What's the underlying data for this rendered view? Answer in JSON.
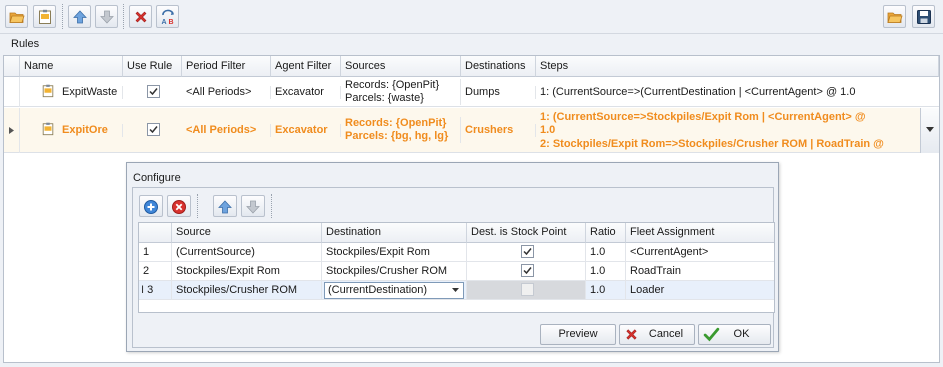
{
  "toolbar": {
    "left_icons": [
      "open-folder-icon",
      "properties-icon",
      "move-up-icon",
      "move-down-icon",
      "delete-icon",
      "rename-icon"
    ],
    "right_icons": [
      "open-folder-icon",
      "save-icon"
    ]
  },
  "rules": {
    "section_label": "Rules",
    "columns": [
      "Name",
      "Use Rule",
      "Period Filter",
      "Agent Filter",
      "Sources",
      "Destinations",
      "Steps"
    ],
    "rows": [
      {
        "name": "ExpitWaste",
        "use_rule": true,
        "period_filter": "<All Periods>",
        "agent_filter": "Excavator",
        "sources_line1": "Records: {OpenPit}",
        "sources_line2": "Parcels: {waste}",
        "destinations": "Dumps",
        "steps_line1": "1: (CurrentSource=>(CurrentDestination | <CurrentAgent> @ 1.0",
        "steps_line2": ""
      },
      {
        "name": "ExpitOre",
        "use_rule": true,
        "period_filter": "<All Periods>",
        "agent_filter": "Excavator",
        "sources_line1": "Records: {OpenPit}",
        "sources_line2": "Parcels: {bg, hg, lg}",
        "destinations": "Crushers",
        "steps_line1": "1: (CurrentSource=>Stockpiles/Expit Rom | <CurrentAgent> @",
        "steps_line2": "1.0",
        "steps_line3": "2: Stockpiles/Expit Rom=>Stockpiles/Crusher ROM | RoadTrain @",
        "selected": true
      }
    ],
    "colors": {
      "selected_text": "#f08c1e",
      "selected_row": "#fdf8ed"
    }
  },
  "configure": {
    "title": "Configure",
    "toolbar_icons": [
      "add-icon",
      "remove-icon",
      "move-up-icon",
      "move-down-icon"
    ],
    "columns": [
      "Source",
      "Destination",
      "Dest. is Stock Point",
      "Ratio",
      "Fleet Assignment"
    ],
    "rows": [
      {
        "num": "1",
        "source": "(CurrentSource)",
        "destination": "Stockpiles/Expit Rom",
        "stock_point": true,
        "ratio": "1.0",
        "fleet": "<CurrentAgent>"
      },
      {
        "num": "2",
        "source": "Stockpiles/Expit Rom",
        "destination": "Stockpiles/Crusher ROM",
        "stock_point": true,
        "ratio": "1.0",
        "fleet": "RoadTrain"
      },
      {
        "num": "3",
        "source": "Stockpiles/Crusher ROM",
        "destination": "(CurrentDestination)",
        "stock_point": false,
        "ratio": "1.0",
        "fleet": "Loader",
        "editing": true
      }
    ],
    "buttons": {
      "preview": "Preview",
      "cancel": "Cancel",
      "ok": "OK"
    }
  }
}
